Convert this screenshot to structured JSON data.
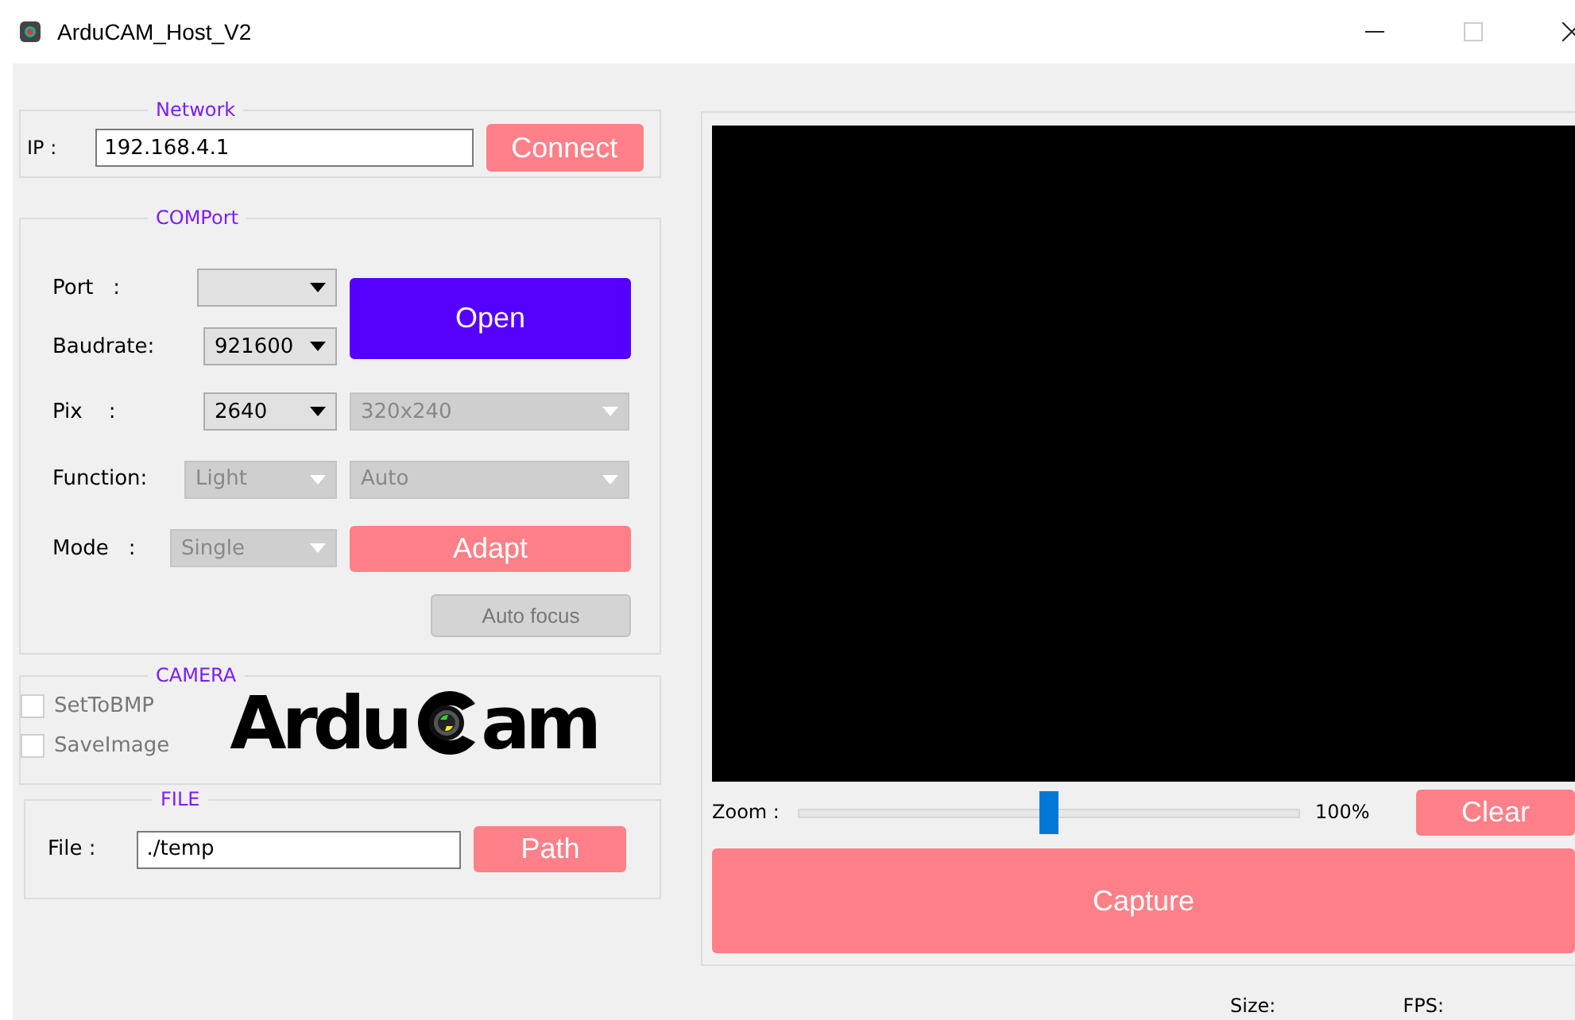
{
  "window": {
    "title": "ArduCAM_Host_V2"
  },
  "network": {
    "title": "Network",
    "ip_label": "IP :",
    "ip_value": "192.168.4.1",
    "connect_button": "Connect"
  },
  "comport": {
    "title": "COMPort",
    "rows": [
      {
        "label": "Port   :",
        "selects": [
          {
            "disabled": false
          }
        ]
      },
      {
        "label": "Baudrate:",
        "selects": [
          {
            "value": "921600",
            "disabled": false
          }
        ]
      },
      {
        "label": "Pix    :",
        "selects": [
          {
            "value": "2640",
            "disabled": false
          },
          {
            "value": "320x240",
            "disabled": true
          }
        ]
      },
      {
        "label": "Function:",
        "selects": [
          {
            "value": "Light",
            "disabled": true
          },
          {
            "value": "Auto",
            "disabled": true
          }
        ]
      },
      {
        "label": "Mode   :",
        "selects": [
          {
            "value": "Single",
            "disabled": true
          }
        ]
      }
    ],
    "open_button": "Open",
    "adapt_button": "Adapt",
    "autofocus_button": {
      "label": "Auto focus",
      "disabled": true
    }
  },
  "camera": {
    "title": "CAMERA",
    "checkboxes": [
      {
        "label": "SetToBMP",
        "checked": false
      },
      {
        "label": "SaveImage",
        "checked": false
      }
    ],
    "logo": {
      "before": "Ardu",
      "after": "am"
    }
  },
  "file": {
    "title": "FILE",
    "label": "File :",
    "value": "./temp",
    "path_button": "Path"
  },
  "preview": {
    "zoom_label": "Zoom :",
    "zoom": {
      "level": 0.5
    },
    "zoom_value": "100%",
    "clear_button": "Clear",
    "capture_button": "Capture"
  },
  "status_bar": {
    "size_label": "Size:",
    "fps_label": "FPS:"
  }
}
